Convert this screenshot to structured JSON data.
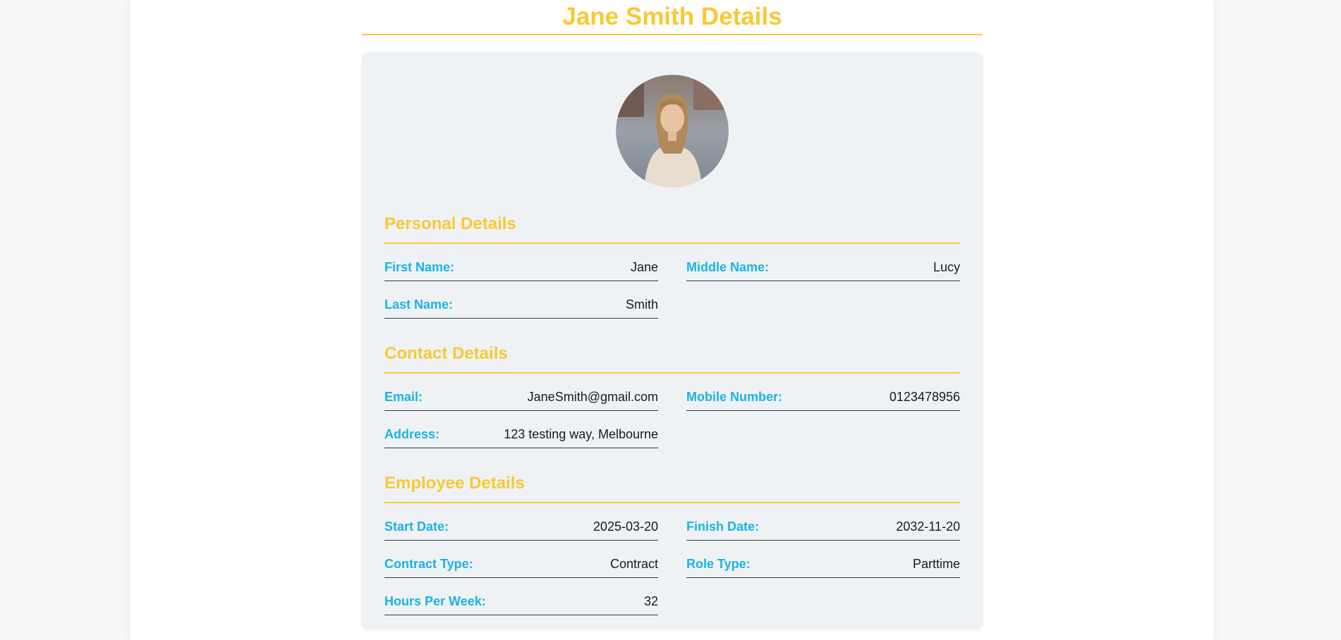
{
  "page": {
    "title": "Jane Smith Details"
  },
  "colors": {
    "accent_yellow": "#f7c934",
    "label_blue": "#1ab2e8",
    "card_bg": "#eff2f4"
  },
  "avatar": {
    "icon": "profile-photo"
  },
  "sections": {
    "personal": {
      "title": "Personal Details",
      "first_name_label": "First Name:",
      "first_name": "Jane",
      "middle_name_label": "Middle Name:",
      "middle_name": "Lucy",
      "last_name_label": "Last Name:",
      "last_name": "Smith"
    },
    "contact": {
      "title": "Contact Details",
      "email_label": "Email:",
      "email": "JaneSmith@gmail.com",
      "mobile_label": "Mobile Number:",
      "mobile": "0123478956",
      "address_label": "Address:",
      "address": "123 testing way, Melbourne"
    },
    "employee": {
      "title": "Employee Details",
      "start_date_label": "Start Date:",
      "start_date": "2025-03-20",
      "finish_date_label": "Finish Date:",
      "finish_date": "2032-11-20",
      "contract_type_label": "Contract Type:",
      "contract_type": "Contract",
      "role_type_label": "Role Type:",
      "role_type": "Parttime",
      "hours_label": "Hours Per Week:",
      "hours": "32"
    }
  }
}
